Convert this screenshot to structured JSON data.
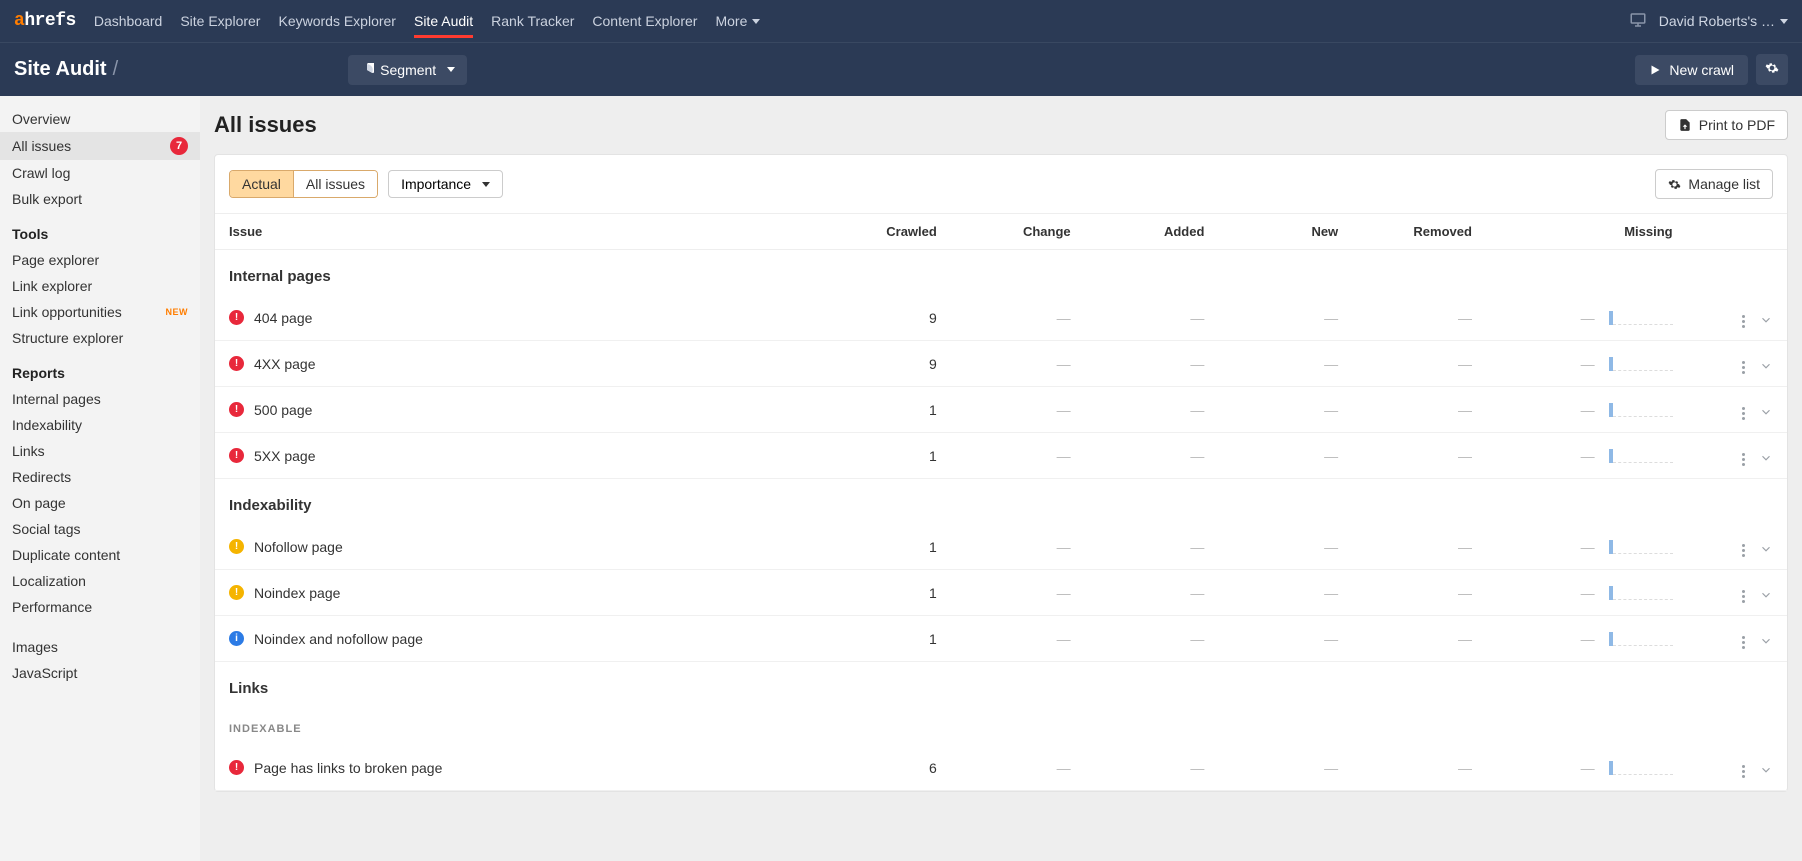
{
  "nav": {
    "items": [
      "Dashboard",
      "Site Explorer",
      "Keywords Explorer",
      "Site Audit",
      "Rank Tracker",
      "Content Explorer",
      "More"
    ],
    "active": "Site Audit",
    "user": "David Roberts's …"
  },
  "subbar": {
    "breadcrumb": "Site Audit",
    "sep": "/",
    "segment": "Segment",
    "new_crawl": "New crawl"
  },
  "sidebar": {
    "top": [
      {
        "label": "Overview"
      },
      {
        "label": "All issues",
        "badge": "7",
        "active": true
      },
      {
        "label": "Crawl log"
      },
      {
        "label": "Bulk export"
      }
    ],
    "tools_heading": "Tools",
    "tools": [
      {
        "label": "Page explorer"
      },
      {
        "label": "Link explorer"
      },
      {
        "label": "Link opportunities",
        "new": "NEW"
      },
      {
        "label": "Structure explorer"
      }
    ],
    "reports_heading": "Reports",
    "reports": [
      {
        "label": "Internal pages"
      },
      {
        "label": "Indexability"
      },
      {
        "label": "Links"
      },
      {
        "label": "Redirects"
      },
      {
        "label": "On page"
      },
      {
        "label": "Social tags"
      },
      {
        "label": "Duplicate content"
      },
      {
        "label": "Localization"
      },
      {
        "label": "Performance"
      }
    ],
    "more": [
      {
        "label": "Images"
      },
      {
        "label": "JavaScript"
      }
    ]
  },
  "main": {
    "title": "All issues",
    "print": "Print to PDF",
    "seg_actual": "Actual",
    "seg_all": "All issues",
    "importance": "Importance",
    "manage": "Manage list",
    "columns": [
      "Issue",
      "Crawled",
      "Change",
      "Added",
      "New",
      "Removed",
      "Missing"
    ],
    "dash": "—",
    "groups": [
      {
        "title": "Internal pages",
        "rows": [
          {
            "sev": "error",
            "name": "404 page",
            "crawled": "9"
          },
          {
            "sev": "error",
            "name": "4XX page",
            "crawled": "9"
          },
          {
            "sev": "error",
            "name": "500 page",
            "crawled": "1"
          },
          {
            "sev": "error",
            "name": "5XX page",
            "crawled": "1"
          }
        ]
      },
      {
        "title": "Indexability",
        "rows": [
          {
            "sev": "warn",
            "name": "Nofollow page",
            "crawled": "1"
          },
          {
            "sev": "warn",
            "name": "Noindex page",
            "crawled": "1"
          },
          {
            "sev": "info",
            "name": "Noindex and nofollow page",
            "crawled": "1"
          }
        ]
      },
      {
        "title": "Links",
        "sub": "INDEXABLE",
        "rows": [
          {
            "sev": "error",
            "name": "Page has links to broken page",
            "crawled": "6"
          }
        ]
      }
    ]
  }
}
